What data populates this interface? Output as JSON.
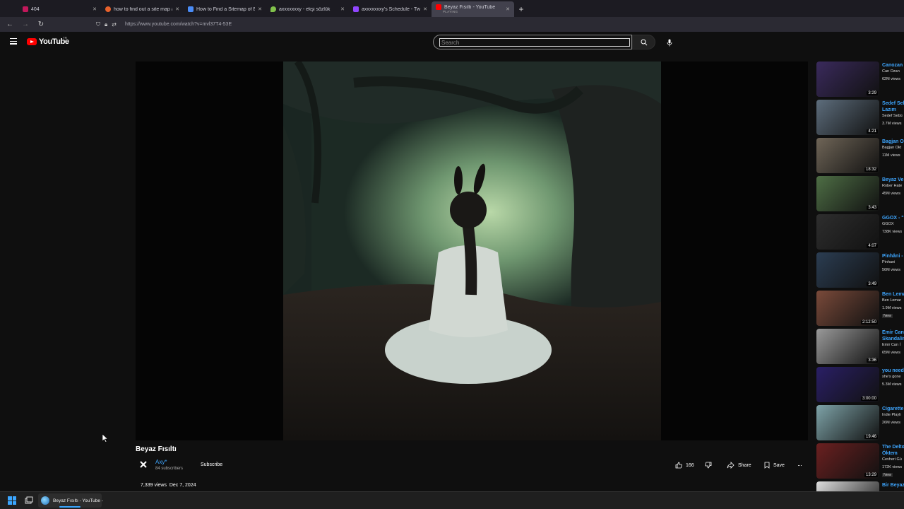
{
  "browser": {
    "tabs": [
      {
        "label": "404",
        "favicon_color": "#c2185b",
        "active": false
      },
      {
        "label": "how to find out a site map at b",
        "favicon_color": "#e8622c",
        "active": false
      },
      {
        "label": "How to Find a Sitemap of Ever",
        "favicon_color": "#4a8cf7",
        "active": false
      },
      {
        "label": "axxxxxxxy - ekşi sözlük",
        "favicon_color": "#81c14b",
        "active": false
      },
      {
        "label": "axxxxxxxy's Schedule - Twitch",
        "favicon_color": "#9146ff",
        "active": false
      },
      {
        "label": "Beyaz Fısıltı - YouTube",
        "sublabel": "PLAYING",
        "favicon_color": "#ff0000",
        "active": true
      }
    ],
    "url": "https://www.youtube.com/watch?v=mvl37T4-53E"
  },
  "youtube": {
    "logo_text": "YouTube",
    "logo_region": "TR",
    "search_placeholder": "Search"
  },
  "video": {
    "title": "Beyaz Fısıltı",
    "channel": "Axy*",
    "subscribers": "84 subscribers",
    "subscribe_label": "Subscribe",
    "likes": "166",
    "share_label": "Share",
    "save_label": "Save",
    "views": "7,339 views",
    "date": "Dec 7, 2024"
  },
  "sidebar": [
    {
      "title": "Canozan",
      "channel": "Can Ozan",
      "views": "62M views",
      "duration": "3:29",
      "thumb": "#3a2a5c"
    },
    {
      "title": "Sedef Sel\nLazım",
      "channel": "Sedef Sebü",
      "views": "3.7M views",
      "duration": "4:21",
      "thumb": "#5d6d7c"
    },
    {
      "title": "Bagjan O",
      "channel": "Bagjan Okt",
      "views": "11M views",
      "duration": "18:32",
      "thumb": "#6f6557"
    },
    {
      "title": "Beyaz Ve",
      "channel": "Rober Hate",
      "views": "45M views",
      "duration": "3:43",
      "thumb": "#4e6e45"
    },
    {
      "title": "GGOX - \"",
      "channel": "GGOX",
      "views": "738K views",
      "duration": "4:07",
      "thumb": "#2e2e2e"
    },
    {
      "title": "Pinhâni -",
      "channel": "Pinhani",
      "views": "56M views",
      "duration": "3:49",
      "thumb": "#2b3d52"
    },
    {
      "title": "Ben Lema",
      "channel": "Ben Lemar",
      "views": "1.9M views",
      "duration": "2:12:50",
      "badge": "New",
      "thumb": "#7a4a3a"
    },
    {
      "title": "Emir Can\nSkandalin",
      "channel": "Emir Can İ",
      "views": "65M views",
      "duration": "3:36",
      "thumb": "#9a9a9a"
    },
    {
      "title": "you need",
      "channel": "she's gone",
      "views": "5.3M views",
      "duration": "3:00:00",
      "thumb": "#2a1f66"
    },
    {
      "title": "Cigarette",
      "channel": "Indie Playli",
      "views": "26M views",
      "duration": "19:46",
      "thumb": "#7ea3a8"
    },
    {
      "title": "The Delto\nÖktem",
      "channel": "Cevheri Gü",
      "views": "172K views",
      "duration": "13:29",
      "badge": "New",
      "thumb": "#6b2020"
    },
    {
      "title": "Bir Beyaz",
      "channel": "",
      "views": "",
      "duration": "",
      "thumb": "#dddddd"
    }
  ],
  "taskbar": {
    "app_label": "Beyaz Fısıltı - YouTube -"
  },
  "colors": {
    "background": "#0f0f0f",
    "link": "#3ea6ff",
    "brand": "#ff0000"
  }
}
